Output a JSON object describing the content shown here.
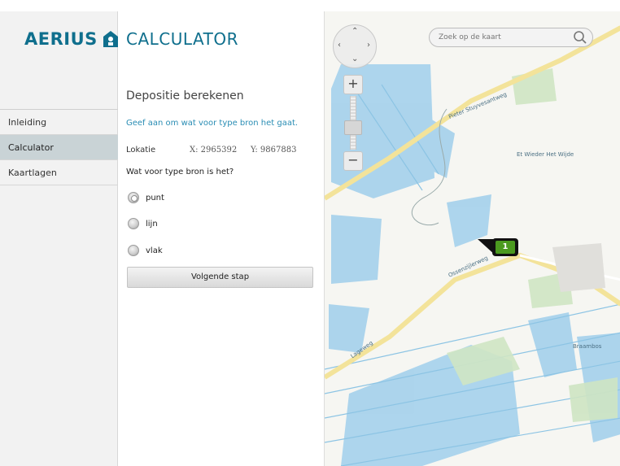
{
  "brand": {
    "name": "AERIUS",
    "accent": "#0f6f8d",
    "icon": "house-logo-icon"
  },
  "sidebar": {
    "items": [
      {
        "label": "Inleiding",
        "active": false
      },
      {
        "label": "Calculator",
        "active": true
      },
      {
        "label": "Kaartlagen",
        "active": false
      }
    ]
  },
  "panel": {
    "title": "CALCULATOR",
    "section_title": "Depositie berekenen",
    "hint": "Geef aan om wat voor type bron het gaat.",
    "location": {
      "label": "Lokatie",
      "x": "X: 2965392",
      "y": "Y: 9867883"
    },
    "question": "Wat voor type bron is het?",
    "options": [
      {
        "label": "punt",
        "checked": true
      },
      {
        "label": "lijn",
        "checked": false
      },
      {
        "label": "vlak",
        "checked": false
      }
    ],
    "next_label": "Volgende stap"
  },
  "map": {
    "search_placeholder": "Zoek op de kaart",
    "marker_label": "1",
    "zoom_in": "+",
    "zoom_out": "−",
    "labels": [
      "Pieter Stuyvesantweg",
      "Et Wieder Het Wijde",
      "Ossenzijlerweg",
      "Lageweg",
      "Braambos"
    ]
  }
}
